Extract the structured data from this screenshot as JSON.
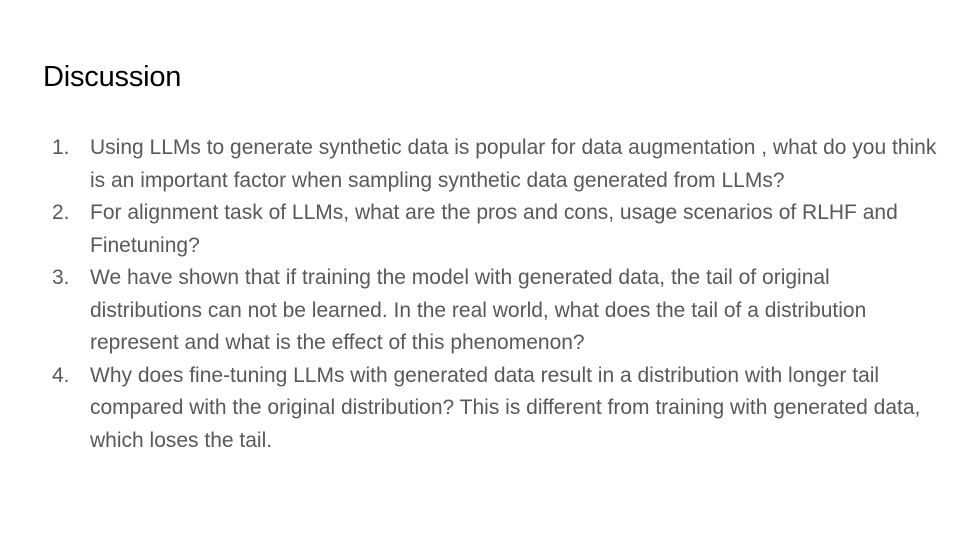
{
  "slide": {
    "title": "Discussion",
    "items": [
      {
        "number": "1.",
        "text": "Using LLMs to generate synthetic data is popular for data augmentation , what do you think is an important factor when sampling synthetic data generated from LLMs?"
      },
      {
        "number": "2.",
        "text": "For alignment task of LLMs, what are the pros and cons, usage scenarios of RLHF and Finetuning?"
      },
      {
        "number": "3.",
        "text": "We have shown that if training the model with generated data, the tail of original distributions can not be learned. In the real world, what does the tail of a distribution represent and what is the effect of this phenomenon?"
      },
      {
        "number": "4.",
        "text": "Why does fine-tuning LLMs with generated data result in a distribution with longer tail compared with the original distribution? This is different from training with generated data, which loses the tail."
      }
    ]
  },
  "colors": {
    "title": "#000000",
    "body_text": "#595959",
    "background": "#ffffff"
  }
}
